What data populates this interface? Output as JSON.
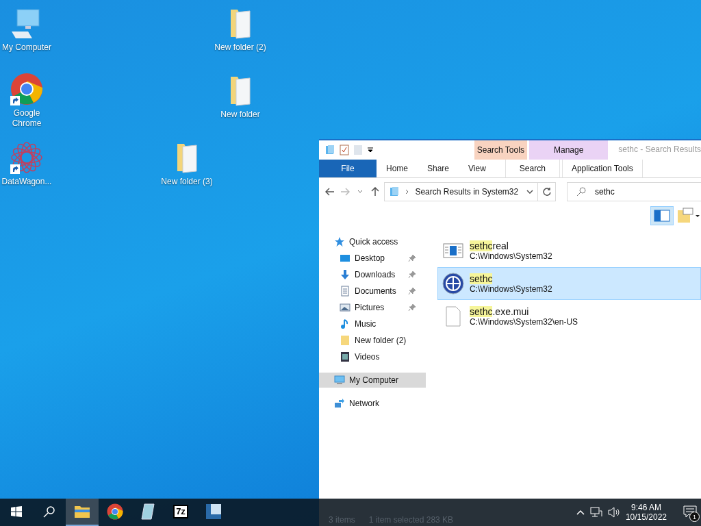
{
  "desktop_icons": [
    {
      "kind": "computer",
      "label": "My Computer",
      "shortcut": false
    },
    {
      "kind": "chrome",
      "label": "Google Chrome",
      "shortcut": true
    },
    {
      "kind": "app",
      "label": "DataWagon...",
      "shortcut": true
    },
    {
      "kind": "folder",
      "label": "New folder (2)",
      "shortcut": false
    },
    {
      "kind": "folder",
      "label": "New folder",
      "shortcut": false
    },
    {
      "kind": "folder",
      "label": "New folder (3)",
      "shortcut": false
    }
  ],
  "explorer": {
    "title": "sethc - Search Results",
    "context_tabs": [
      {
        "group": "Search Tools",
        "tab": "Search",
        "color": "#f8d3c0"
      },
      {
        "group": "Manage",
        "tab": "Application Tools",
        "color": "#ead3f5"
      }
    ],
    "ribbon_tabs": [
      {
        "label": "File",
        "selected": true
      },
      {
        "label": "Home",
        "selected": false
      },
      {
        "label": "Share",
        "selected": false
      },
      {
        "label": "View",
        "selected": false
      }
    ],
    "address": "Search Results in System32",
    "search": {
      "value": "sethc"
    },
    "nav": [
      {
        "kind": "quick",
        "label": "Quick access",
        "pinned": false,
        "selected": false,
        "children": [
          {
            "kind": "desktop",
            "label": "Desktop",
            "pinned": true,
            "selected": false
          },
          {
            "kind": "downloads",
            "label": "Downloads",
            "pinned": true,
            "selected": false
          },
          {
            "kind": "documents",
            "label": "Documents",
            "pinned": true,
            "selected": false
          },
          {
            "kind": "pictures",
            "label": "Pictures",
            "pinned": true,
            "selected": false
          },
          {
            "kind": "music",
            "label": "Music",
            "pinned": false,
            "selected": false
          },
          {
            "kind": "folder",
            "label": "New folder (2)",
            "pinned": false,
            "selected": false
          },
          {
            "kind": "videos",
            "label": "Videos",
            "pinned": false,
            "selected": false
          }
        ]
      },
      {
        "kind": "computer",
        "label": "My Computer",
        "pinned": false,
        "selected": true
      },
      {
        "kind": "network",
        "label": "Network",
        "pinned": false,
        "selected": false
      }
    ],
    "results": [
      {
        "kind": "window",
        "match": "sethc",
        "rest": "real",
        "path": "C:\\Windows\\System32",
        "selected": false
      },
      {
        "kind": "app",
        "match": "sethc",
        "path": "C:\\Windows\\System32",
        "selected": true
      },
      {
        "kind": "file",
        "match": "sethc",
        "rest": ".exe.mui",
        "path": "C:\\Windows\\System32\\en-US",
        "selected": false
      }
    ],
    "status_bar": [
      "3 items",
      "1 item selected  283 KB"
    ]
  },
  "taskbar": {
    "apps": [
      {
        "kind": "explorer",
        "active": true
      },
      {
        "kind": "chrome",
        "active": false
      },
      {
        "kind": "notepad",
        "active": false
      },
      {
        "kind": "sevenzip",
        "label": "7z",
        "active": false
      },
      {
        "kind": "box",
        "active": false
      }
    ],
    "time": "9:46 AM",
    "date": "10/15/2022",
    "notifications": "1"
  }
}
